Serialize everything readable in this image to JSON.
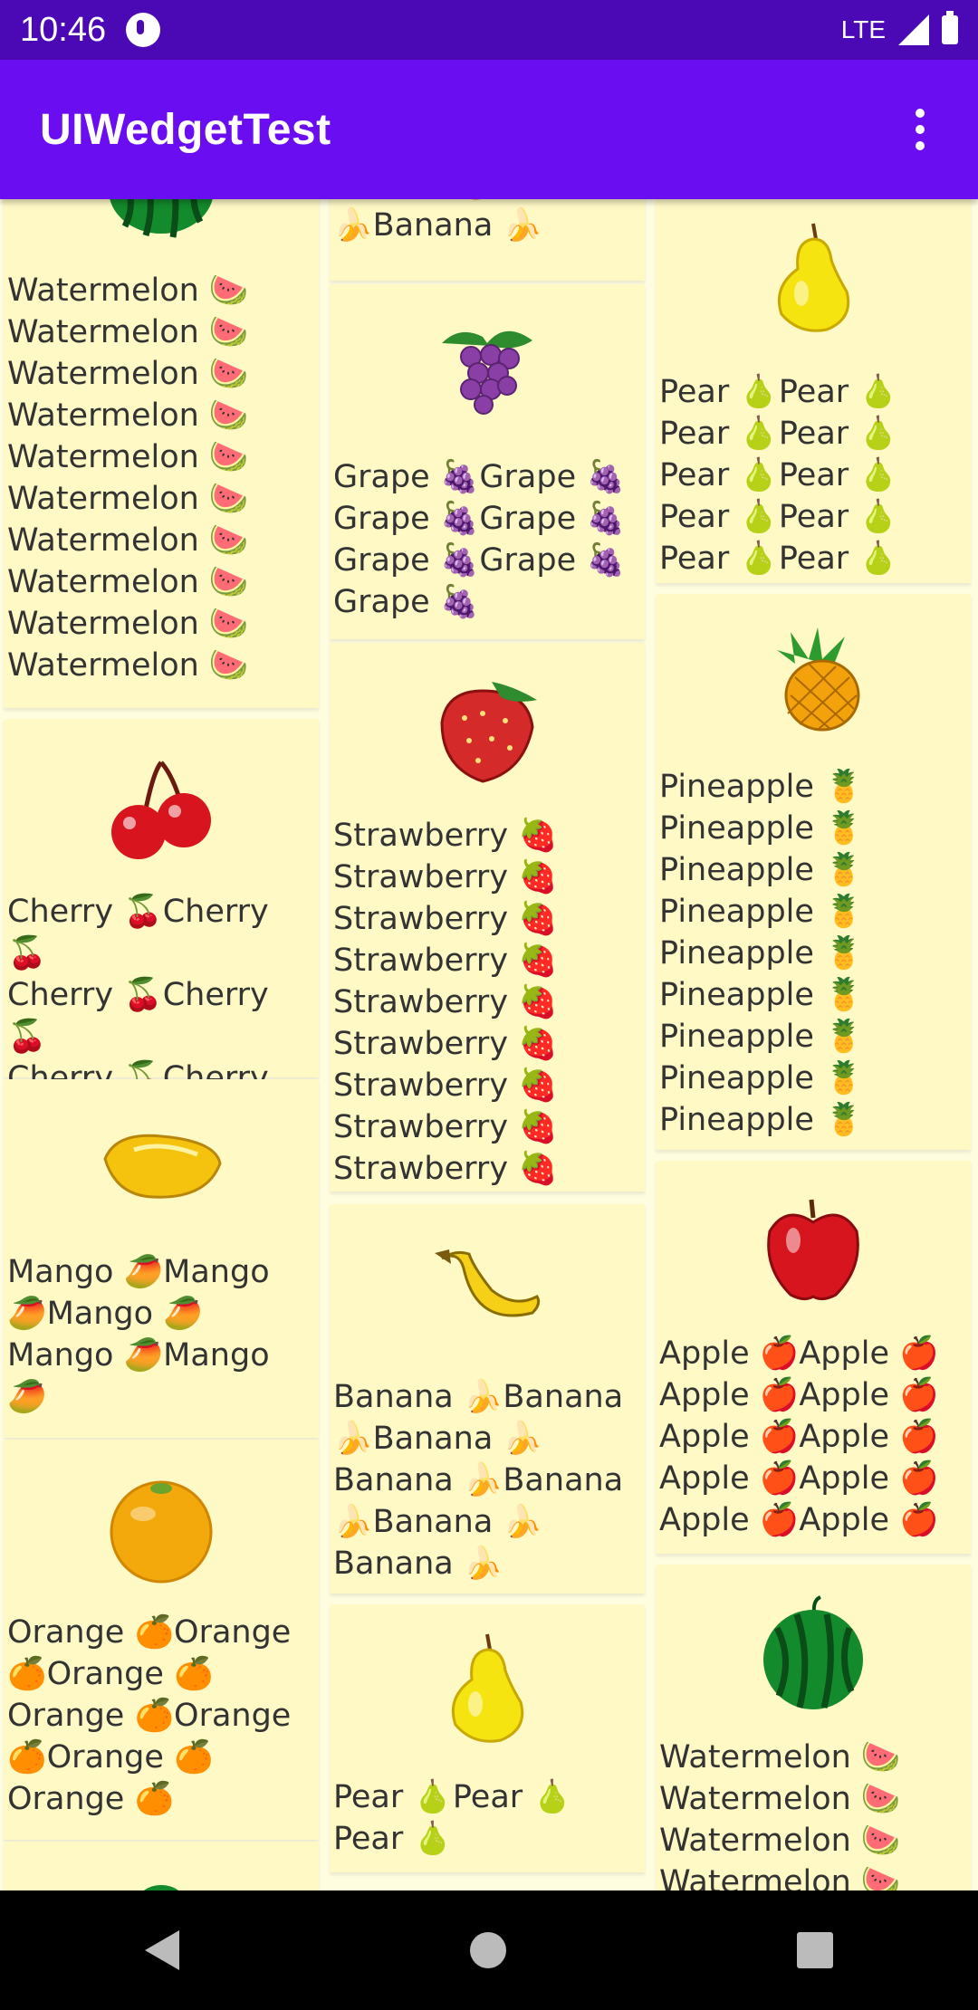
{
  "status": {
    "time": "10:46",
    "network": "LTE"
  },
  "appbar": {
    "title": "UIWedgetTest"
  },
  "cards": {
    "c0": "Banana 🍌Banana 🍌Banana 🍌",
    "c1": "Watermelon 🍉\nWatermelon 🍉\nWatermelon 🍉\nWatermelon 🍉\nWatermelon 🍉\nWatermelon 🍉\nWatermelon 🍉\nWatermelon 🍉\nWatermelon 🍉\nWatermelon 🍉",
    "c2": "Pear 🍐Pear 🍐\nPear 🍐Pear 🍐\nPear 🍐Pear 🍐\nPear 🍐Pear 🍐\nPear 🍐Pear 🍐",
    "c3": "Grape 🍇Grape 🍇\nGrape 🍇Grape 🍇\nGrape 🍇Grape 🍇\nGrape 🍇",
    "c4": "Pineapple 🍍\nPineapple 🍍\nPineapple 🍍\nPineapple 🍍\nPineapple 🍍\nPineapple 🍍\nPineapple 🍍\nPineapple 🍍\nPineapple 🍍",
    "c5": "Cherry 🍒Cherry 🍒\nCherry 🍒Cherry 🍒\nCherry 🍒Cherry 🍒\nCherry 🍒",
    "c6": "Strawberry 🍓\nStrawberry 🍓\nStrawberry 🍓\nStrawberry 🍓\nStrawberry 🍓\nStrawberry 🍓\nStrawberry 🍓\nStrawberry 🍓\nStrawberry 🍓",
    "c7": "Mango 🥭Mango\n🥭Mango 🥭\nMango 🥭Mango\n🥭",
    "c8": "Banana 🍌Banana\n🍌Banana 🍌\nBanana 🍌Banana\n🍌Banana 🍌\nBanana 🍌",
    "c9": "Apple 🍎Apple 🍎\nApple 🍎Apple 🍎\nApple 🍎Apple 🍎\nApple 🍎Apple 🍎\nApple 🍎Apple 🍎",
    "c10": "Orange 🍊Orange\n🍊Orange 🍊\nOrange 🍊Orange\n🍊Orange 🍊\nOrange 🍊",
    "c11": "Pear 🍐Pear 🍐\nPear 🍐",
    "c12": "Watermelon 🍉\nWatermelon 🍉\nWatermelon 🍉\nWatermelon 🍉"
  }
}
